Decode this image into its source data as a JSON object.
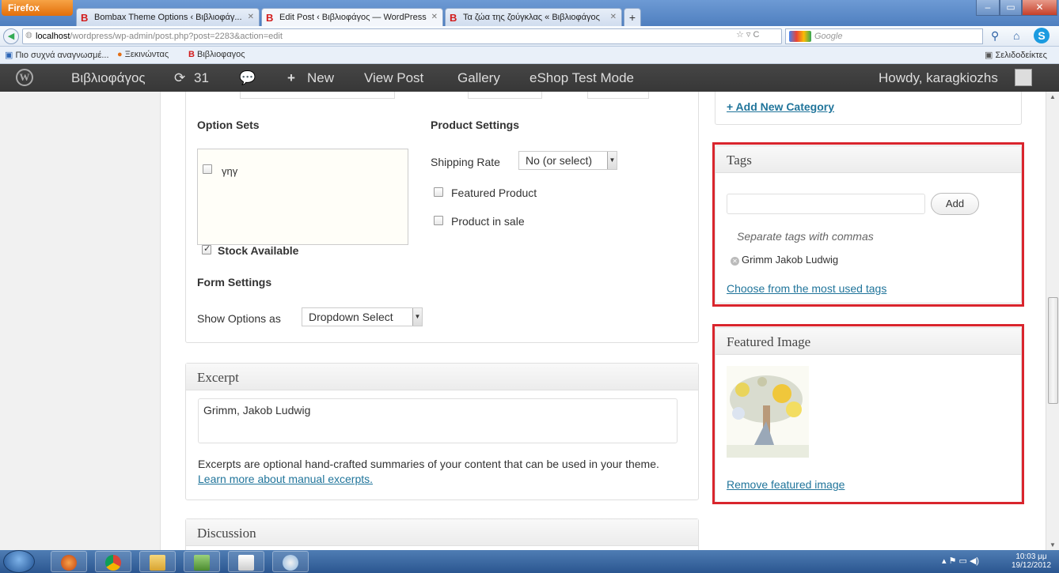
{
  "browser": {
    "menu_button": "Firefox",
    "tabs": [
      {
        "label": "Bombax Theme Options ‹ Βιβλιοφάγ...",
        "favicon": "B"
      },
      {
        "label": "Edit Post ‹ Βιβλιοφάγος — WordPress",
        "favicon": "B"
      },
      {
        "label": "Τα ζώα της ζούγκλας « Βιβλιοφάγος",
        "favicon": "B"
      }
    ],
    "new_tab": "+",
    "window_controls": [
      "–",
      "▭",
      "✕"
    ],
    "url_host": "localhost",
    "url_path": "/wordpress/wp-admin/post.php?post=2283&action=edit",
    "search_placeholder": "Google",
    "bookmarks": [
      {
        "label": "Πιο συχνά αναγνωσμέ...",
        "icon": "bookmark-icon"
      },
      {
        "label": "Ξεκινώντας",
        "icon": "firefox-icon"
      },
      {
        "label": "Βιβλιοφαγος",
        "icon": "b-favicon"
      }
    ],
    "bookmarks_menu": "Σελιδοδείκτες"
  },
  "adminbar": {
    "site_name": "Βιβλιοφάγος",
    "updates_count": "31",
    "new_label": "New",
    "view_post": "View Post",
    "gallery": "Gallery",
    "eshop_mode": "eShop Test Mode",
    "howdy": "Howdy, karagkiozhs"
  },
  "product_box": {
    "option_sets_heading": "Option Sets",
    "option_set_item": "γηγ",
    "stock_available": "Stock Available",
    "product_settings_heading": "Product Settings",
    "shipping_rate_label": "Shipping Rate",
    "shipping_rate_value": "No (or select)",
    "featured_product": "Featured Product",
    "product_in_sale": "Product in sale",
    "form_settings_heading": "Form Settings",
    "show_options_label": "Show Options as",
    "show_options_value": "Dropdown Select"
  },
  "excerpt": {
    "title": "Excerpt",
    "value": "Grimm, Jakob Ludwig",
    "help_text": "Excerpts are optional hand-crafted summaries of your content that can be used in your theme.",
    "help_link": "Learn more about manual excerpts."
  },
  "discussion": {
    "title": "Discussion"
  },
  "categories": {
    "add_new": "+ Add New Category"
  },
  "tags": {
    "title": "Tags",
    "input_value": "",
    "add_button": "Add",
    "hint": "Separate tags with commas",
    "tag_items": [
      "Grimm Jakob Ludwig"
    ],
    "choose_link": "Choose from the most used tags"
  },
  "featured_image": {
    "title": "Featured Image",
    "remove_link": "Remove featured image"
  },
  "taskbar": {
    "apps": [
      "windows-orb",
      "firefox",
      "chrome",
      "explorer",
      "network",
      "pdf",
      "paint"
    ],
    "clock_time": "10:03 μμ",
    "clock_date": "19/12/2012"
  },
  "colors": {
    "highlight_frame": "#d9252d",
    "admin_bar": "#464646",
    "link": "#21759b"
  }
}
